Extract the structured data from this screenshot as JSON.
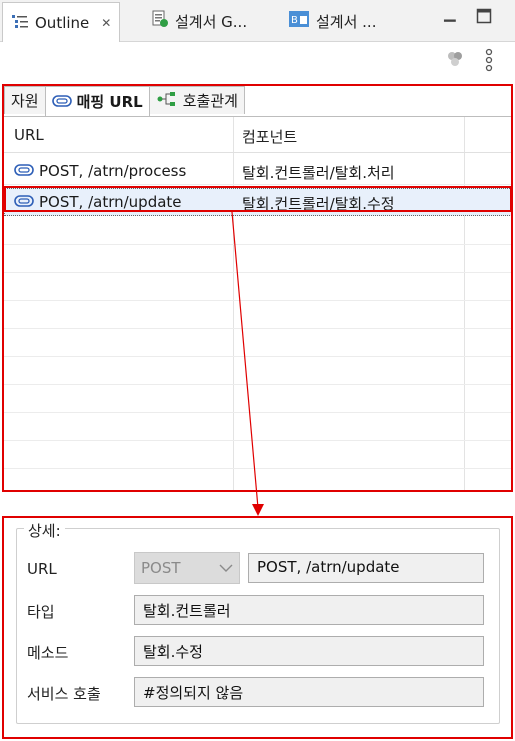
{
  "view_tabs": [
    {
      "label": "Outline",
      "icon": "outline-icon",
      "active": true
    },
    {
      "label": "설계서 G...",
      "icon": "design-doc-icon",
      "active": false
    },
    {
      "label": "설계서 ...",
      "icon": "design-doc-blue-icon",
      "active": false
    }
  ],
  "inner_tabs": [
    {
      "label": "자원"
    },
    {
      "label": "매핑 URL"
    },
    {
      "label": "호출관계"
    }
  ],
  "table": {
    "columns": [
      "URL",
      "컴포넌트"
    ],
    "rows": [
      {
        "url": "POST, /atrn/process",
        "component": "탈회.컨트롤러/탈회.처리"
      },
      {
        "url": "POST, /atrn/update",
        "component": "탈회.컨트롤러/탈회.수정"
      }
    ]
  },
  "details": {
    "title": "상세:",
    "url_label": "URL",
    "method_value": "POST",
    "url_value": "POST, /atrn/update",
    "type_label": "타입",
    "type_value": "탈회.컨트롤러",
    "method_label": "메소드",
    "method_name_value": "탈회.수정",
    "service_label": "서비스 호출",
    "service_value": "#정의되지 않음"
  },
  "colors": {
    "highlight": "#e00000",
    "selection": "#e8f0fb"
  }
}
